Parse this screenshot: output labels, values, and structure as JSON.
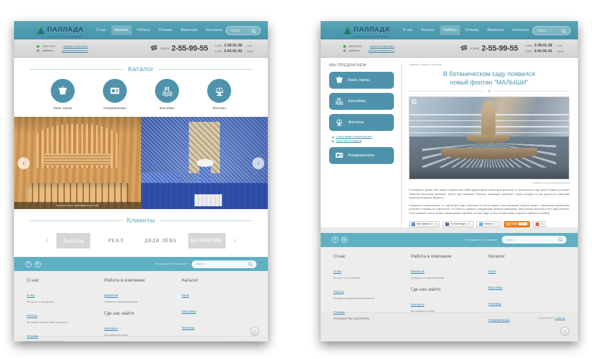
{
  "header": {
    "logo_text": "ПАЛЛАДА",
    "logo_sub": "проектно-строительная компания",
    "nav": [
      {
        "label": "О нас",
        "active": false
      },
      {
        "label": "Каталог",
        "active": true
      },
      {
        "label": "Работы",
        "active": false
      },
      {
        "label": "Отзывы",
        "active": false
      },
      {
        "label": "Вакансии",
        "active": false
      },
      {
        "label": "Контакты",
        "active": false
      }
    ],
    "nav_active_right": "Работы",
    "search_placeholder": "Найти"
  },
  "contacts": {
    "icq_1": "362071913",
    "icq_2": "pallada-m",
    "mail_1": "pallada-info@mail.ru",
    "mail_2": "pallada-info@inbox.ru",
    "phone_code": "8 (862)",
    "phone_main": "2-55-99-55",
    "extra": [
      {
        "code": "8 (988)",
        "number": "2-39-01-39",
        "city": "— Сочи"
      },
      {
        "code": "8 (862)",
        "number": "2-41-01-41",
        "city": "— Адлер"
      }
    ]
  },
  "catalog_section": {
    "title": "Каталог",
    "items": [
      {
        "label": "Бани, сауны",
        "icon": "sauna-bucket-icon"
      },
      {
        "label": "Кондиционеры",
        "icon": "air-conditioner-icon"
      },
      {
        "label": "Бассейны",
        "icon": "pool-icon"
      },
      {
        "label": "Фонтаны",
        "icon": "fountain-icon"
      }
    ]
  },
  "slider": {
    "caption": "Баня частного пользования (г.Сочи)",
    "prev_icon": "chevron-left-icon",
    "next_icon": "chevron-right-icon"
  },
  "clients_section": {
    "title": "Клиенты",
    "logos": [
      "Sakura",
      "РЕАЛ",
      "ДЯДЯ ЛЁВА",
      "ВАЛЕНТИН"
    ]
  },
  "foot_band": {
    "social": [
      "f",
      "в"
    ],
    "find_label": "Не нашли то, что искали?",
    "search_placeholder": "Найти"
  },
  "footer": {
    "columns": [
      {
        "title": "О нас",
        "links": [
          {
            "label": "О нас",
            "desc": "Кто мы и что мы делаем."
          },
          {
            "label": "Работы",
            "desc": "Вы можете изучить наше портфолио."
          },
          {
            "label": "Отзывы",
            "desc": "Что думают о нас наши клиенты."
          }
        ]
      },
      {
        "title": "Работа в компании",
        "links": [
          {
            "label": "Вакансии",
            "desc": "Требуется толковый работник."
          }
        ],
        "title2": "Где нас найти",
        "links2": [
          {
            "label": "Контакты",
            "desc": "Как связаться с нами."
          }
        ]
      },
      {
        "title": "Каталог",
        "cat_links": [
          "Бани",
          "Бассейны",
          "Фонтаны",
          "Кондиционеры"
        ]
      }
    ],
    "copyright": "ООО \"ПАЛЛАДА\" © 2009-2011",
    "dev_label": "Разработано:",
    "dev_name": "Cortex.ru",
    "up_icon": "arrow-up-icon"
  },
  "inner": {
    "sidebar_title": "МЫ ПРЕДЛАГАЕМ:",
    "sidebar_buttons": [
      {
        "label": "Бани, сауны",
        "icon": "sauna-bucket-icon"
      },
      {
        "label": "Бассейны",
        "icon": "pool-icon"
      },
      {
        "label": "Фонтаны",
        "icon": "fountain-icon"
      }
    ],
    "sidebar_sublinks": [
      "С чего начать строительство",
      "Как устроить водоем"
    ],
    "sidebar_last": {
      "label": "Кондиционеры",
      "icon": "air-conditioner-icon"
    },
    "breadcrumb": "Главная / Работы / Фонтаны",
    "title_line1": "В ботаническом саду появился",
    "title_line2": "новый фонтан \"МАЛЫШИ\"",
    "photo_note": "*кликните на фото для увеличения",
    "photo_zoom_icon": "magnifier-icon",
    "paragraph_1": "В ближайшее время Киев сможет похвастаться новой удивительной скульптурой-фонтаном. В ботаническом саду имени Фомина установят \"памятник маленьким кораблям\". Проект под названием \"Малыши, пускающие кораблики\" создал молодой на уже достаточно известный скульптор Владимир Журавель.",
    "paragraph_2": "Изначально планировалось, что скульптуры будут выполнены из белого камня в трех мальчиков, которые играют с бумажными корабликами установят в беседку по отдельности. Но чтобы не нарушить придуманную автором композицию, было решено выполнить её в виде фонтана. Скоро киевляне смогут своими глазами увидеть детишек, которые будут стоять на карте киева и пускать кораблики по Днепру.",
    "share": [
      {
        "network": "vk",
        "label": "Мне нравится",
        "count": "+6"
      },
      {
        "network": "fb",
        "label": "Я рекомендую",
        "count": "1"
      },
      {
        "network": "tw",
        "label": "Твитнуть",
        "count": "0"
      },
      {
        "network": "ok",
        "label": "Класс",
        "count": "1 121"
      },
      {
        "network": "gp",
        "label": "+1",
        "count": "+1"
      }
    ]
  }
}
